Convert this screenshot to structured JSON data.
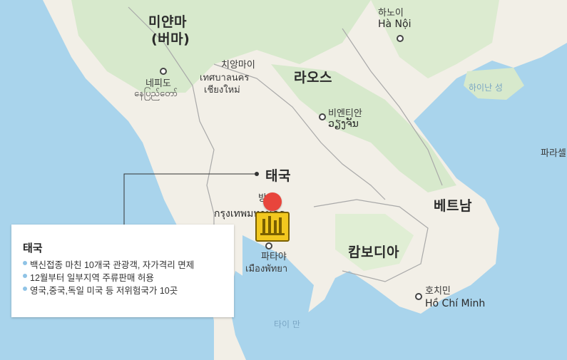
{
  "map": {
    "countries": [
      {
        "id": "myanmar-1",
        "text": "미얀마"
      },
      {
        "id": "myanmar-2",
        "text": "(버마)"
      },
      {
        "id": "laos",
        "text": "라오스"
      },
      {
        "id": "thailand",
        "text": "태국"
      },
      {
        "id": "cambodia",
        "text": "캄보디아"
      },
      {
        "id": "vietnam",
        "text": "베트남"
      }
    ],
    "cities": {
      "hanoi_ko": "하노이",
      "hanoi_local": "Hà Nội",
      "naypyidaw_ko": "네피도",
      "naypyidaw_local": "နေပြည်တော်",
      "chiangmai_ko": "치앙마이",
      "chiangmai_local1": "เทศบาลนคร",
      "chiangmai_local2": "เชียงใหม่",
      "vientiane_ko": "비엔티안",
      "vientiane_local": "ວຽງຈັນ",
      "bangkok_ko": "방콕",
      "bangkok_local": "กรุงเทพมหานคร",
      "pattaya_ko": "파타야",
      "pattaya_local": "เมืองพัทยา",
      "hcm_ko": "호치민",
      "hcm_local": "Hồ Chí Minh",
      "paracel": "파라셀"
    },
    "seas": {
      "hainan": "하이난 성",
      "gulf_thailand": "타이 만"
    },
    "marker_icon": "map-pin-icon",
    "badge_icon": "tax-free-badge-icon"
  },
  "info": {
    "title": "태국",
    "items": [
      "백신접종 마친 10개국 관광객, 자가격리 면제",
      "12월부터 일부지역 주류판매 허용",
      "영국,중국,독일 미국 등 저위험국가 10곳"
    ]
  },
  "colors": {
    "sea": "#a9d4ec",
    "land": "#f2efe7",
    "forest": "#d2e6c6",
    "marker": "#e8453c",
    "badge": "#f2c81f"
  }
}
